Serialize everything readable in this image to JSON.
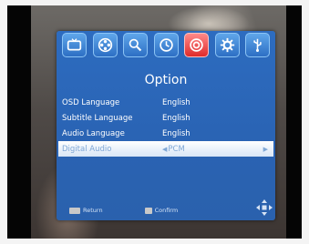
{
  "menu": {
    "tabs": [
      {
        "icon": "tv-icon"
      },
      {
        "icon": "film-reel-icon"
      },
      {
        "icon": "search-icon"
      },
      {
        "icon": "clock-icon"
      },
      {
        "icon": "target-icon"
      },
      {
        "icon": "gear-icon"
      },
      {
        "icon": "usb-icon"
      }
    ],
    "active_tab_index": 4,
    "title": "Option",
    "rows": [
      {
        "label": "OSD Language",
        "value": "English"
      },
      {
        "label": "Subtitle Language",
        "value": "English"
      },
      {
        "label": "Audio Language",
        "value": "English"
      },
      {
        "label": "Digital Audio",
        "value": "PCM",
        "selected": true
      }
    ],
    "footer": {
      "return_label": "Return",
      "confirm_label": "Confirm"
    }
  },
  "colors": {
    "panel": "#2d6cc0",
    "active_tab": "#e02b2b",
    "selected_row": "#ffffff"
  }
}
